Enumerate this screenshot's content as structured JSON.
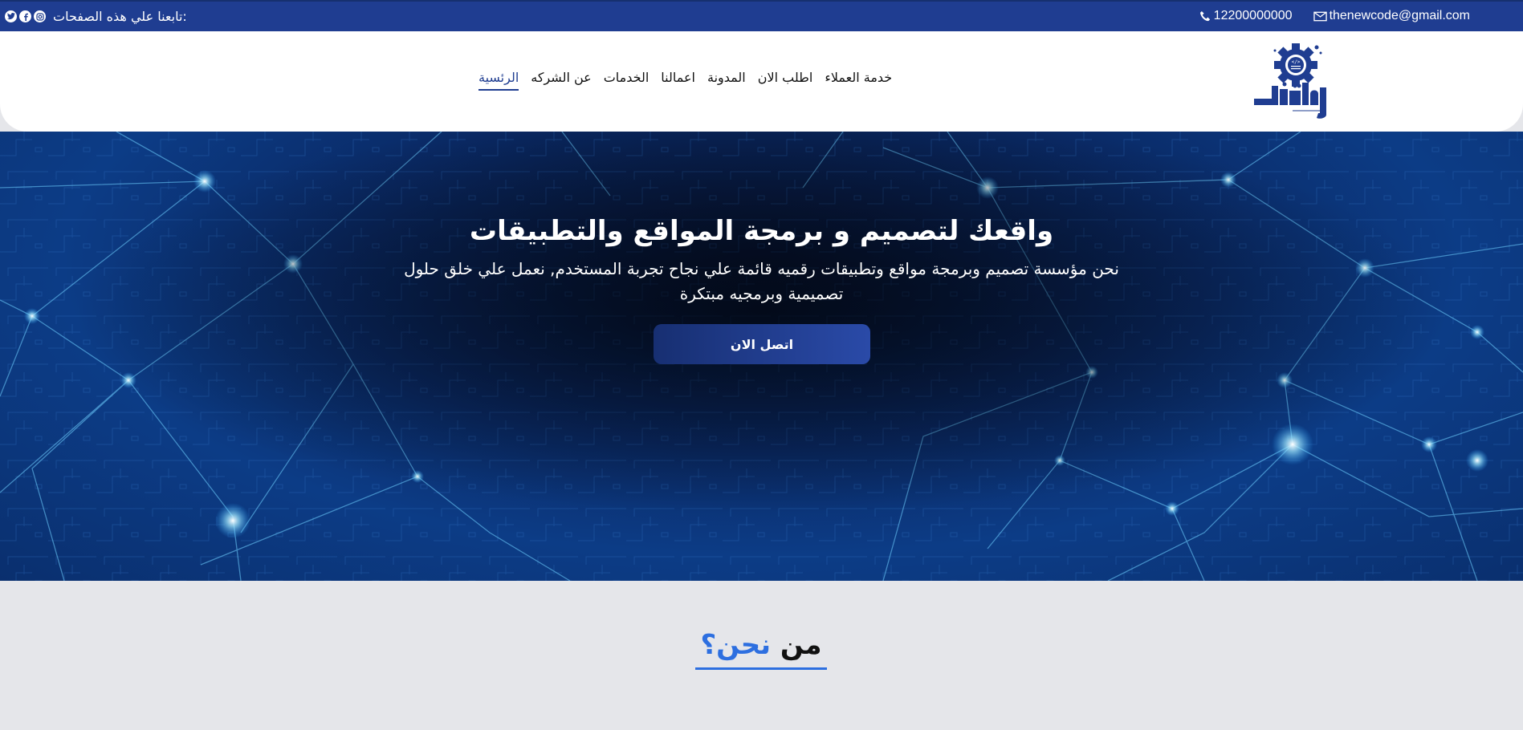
{
  "topbar": {
    "email": "thenewcode@gmail.com",
    "phone": "12200000000",
    "follow_label": "تابعنا علي هذه الصفحات:",
    "social_icons": [
      "twitter-icon",
      "facebook-icon",
      "instagram-icon"
    ]
  },
  "header": {
    "nav": [
      {
        "label": "الرئسية",
        "active": true
      },
      {
        "label": "عن الشركه"
      },
      {
        "label": "الخدمات"
      },
      {
        "label": "اعمالنا"
      },
      {
        "label": "المدونة"
      },
      {
        "label": "اطلب الان"
      },
      {
        "label": "خدمة العملاء"
      }
    ]
  },
  "hero": {
    "title": "واقعك لتصميم و برمجة المواقع والتطبيقات",
    "subtitle": "نحن مؤسسة تصميم وبرمجة مواقع وتطبيقات رقميه قائمة علي نجاح تجربة المستخدم, نعمل علي خلق حلول تصميمية وبرمجيه مبتكرة",
    "cta_label": "اتصل الان"
  },
  "about": {
    "heading_word1": "من",
    "heading_word2": "نحن؟"
  },
  "colors": {
    "brand": "#1f3d91",
    "accent": "#2d6fe0",
    "hero_bg": "#0a2a66"
  }
}
